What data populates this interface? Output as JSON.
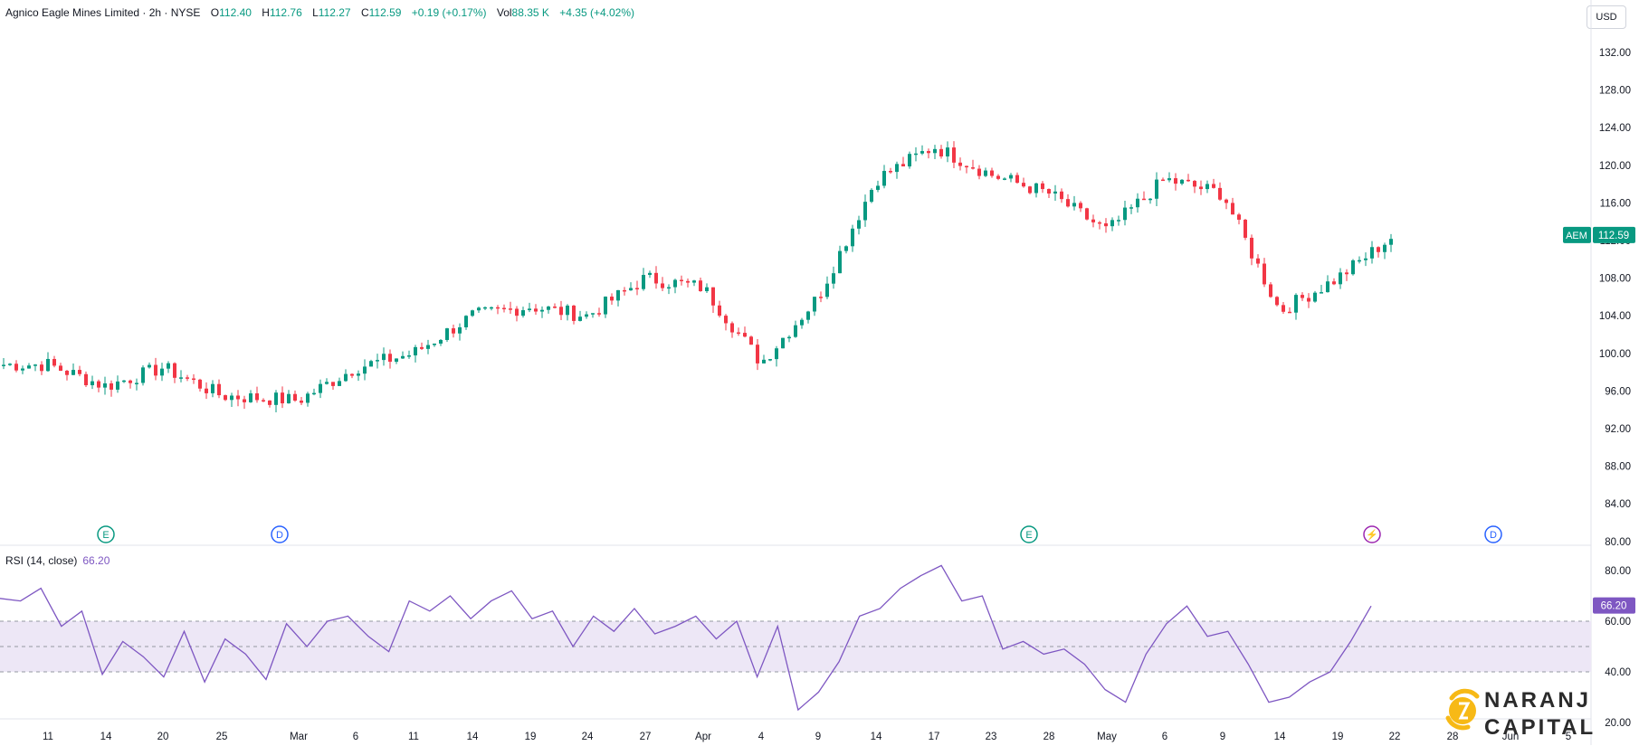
{
  "legend": {
    "symbol_name": "Agnico Eagle Mines Limited · 2h · NYSE",
    "open_label": "O",
    "open": "112.40",
    "high_label": "H",
    "high": "112.76",
    "low_label": "L",
    "low": "112.27",
    "close_label": "C",
    "close": "112.59",
    "change": "+0.19 (+0.17%)",
    "vol_label": "Vol",
    "vol": "88.35 K",
    "vol_change": "+4.35 (+4.02%)"
  },
  "currency": "USD",
  "price_tag": {
    "ticker": "AEM",
    "price": "112.59",
    "color": "#089981"
  },
  "rsi": {
    "title": "RSI (14, close)",
    "value": "66.20",
    "color": "#7e57c2"
  },
  "colors": {
    "up": "#089981",
    "down": "#f23645",
    "rsi_line": "#7e57c2",
    "rsi_band": "#ede7f6"
  },
  "events": [
    {
      "type": "earnings",
      "letter": "E",
      "color": "#089981"
    },
    {
      "type": "dividend",
      "letter": "D",
      "color": "#2962ff"
    },
    {
      "type": "earnings",
      "letter": "E",
      "color": "#089981"
    },
    {
      "type": "split",
      "letter": "⚡",
      "color": "#9c27b0"
    },
    {
      "type": "dividend",
      "letter": "D",
      "color": "#2962ff"
    }
  ],
  "chart_data": [
    {
      "type": "candlestick",
      "title": "Agnico Eagle Mines Limited · 2h · NYSE",
      "ylim": [
        80,
        134
      ],
      "y_ticks": [
        "132.00",
        "128.00",
        "124.00",
        "120.00",
        "116.00",
        "112.00",
        "108.00",
        "104.00",
        "100.00",
        "96.00",
        "92.00",
        "88.00",
        "84.00",
        "80.00"
      ],
      "x_ticks": [
        "11",
        "14",
        "20",
        "25",
        "Mar",
        "6",
        "11",
        "14",
        "19",
        "24",
        "27",
        "Apr",
        "4",
        "9",
        "14",
        "17",
        "23",
        "28",
        "May",
        "6",
        "9",
        "14",
        "19",
        "22",
        "28",
        "Jun",
        "5"
      ],
      "anchors": [
        {
          "x_tick": "11",
          "price": 98.8
        },
        {
          "x_tick": "14",
          "price": 96.5
        },
        {
          "x_tick": "20",
          "price": 98.5
        },
        {
          "x_tick": "25",
          "price": 95.5
        },
        {
          "x_tick": "Mar",
          "price": 95.0
        },
        {
          "x_tick": "6",
          "price": 98.5
        },
        {
          "x_tick": "11",
          "price": 100.0
        },
        {
          "x_tick": "14",
          "price": 104.0
        },
        {
          "x_tick": "19",
          "price": 105.0
        },
        {
          "x_tick": "24",
          "price": 104.0
        },
        {
          "x_tick": "27",
          "price": 108.0
        },
        {
          "x_tick": "Apr",
          "price": 107.0
        },
        {
          "x_tick": "4",
          "price": 99.0
        },
        {
          "x_tick": "9",
          "price": 106.0
        },
        {
          "x_tick": "14",
          "price": 118.5
        },
        {
          "x_tick": "17",
          "price": 122.0
        },
        {
          "x_tick": "23",
          "price": 119.0
        },
        {
          "x_tick": "28",
          "price": 117.0
        },
        {
          "x_tick": "May",
          "price": 113.0
        },
        {
          "x_tick": "6",
          "price": 118.5
        },
        {
          "x_tick": "9",
          "price": 117.0
        },
        {
          "x_tick": "14",
          "price": 104.5
        },
        {
          "x_tick": "19",
          "price": 108.0
        },
        {
          "x_tick": "22",
          "price": 112.6
        }
      ]
    },
    {
      "type": "line",
      "title": "RSI (14, close)",
      "ylim": [
        20,
        85
      ],
      "y_ticks": [
        "80.00",
        "60.00",
        "40.00",
        "20.00"
      ],
      "bands": [
        40,
        50,
        60
      ],
      "series": [
        {
          "values": [
            69,
            68,
            73,
            58,
            64,
            39,
            52,
            46,
            38,
            56,
            36,
            53,
            47,
            37,
            59,
            50,
            60,
            62,
            54,
            48,
            68,
            64,
            70,
            61,
            68,
            72,
            61,
            64,
            50,
            62,
            56,
            65,
            55,
            58,
            62,
            53,
            60,
            38,
            58,
            25,
            32,
            44,
            62,
            65,
            73,
            78,
            82,
            68,
            70,
            49,
            52,
            47,
            49,
            43,
            33,
            28,
            47,
            59,
            66,
            54,
            56,
            43,
            28,
            30,
            36,
            40,
            52,
            66
          ]
        }
      ]
    }
  ]
}
